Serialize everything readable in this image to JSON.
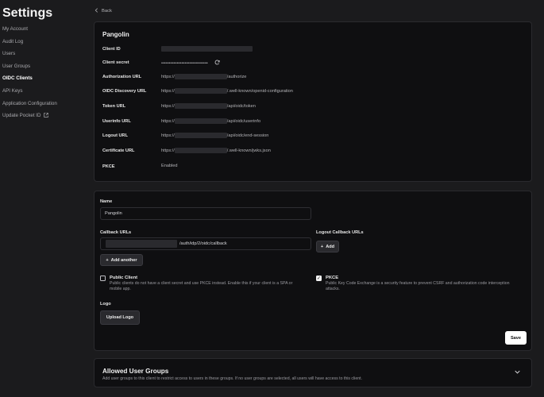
{
  "sidebar": {
    "title": "Settings",
    "items": [
      {
        "label": "My Account"
      },
      {
        "label": "Audit Log"
      },
      {
        "label": "Users"
      },
      {
        "label": "User Groups"
      },
      {
        "label": "OIDC Clients",
        "active": true
      },
      {
        "label": "API Keys"
      },
      {
        "label": "Application Configuration"
      },
      {
        "label": "Update Pocket ID"
      }
    ]
  },
  "back": {
    "label": "Back"
  },
  "client": {
    "name": "Pangolin",
    "fields": {
      "client_id": {
        "label": "Client ID"
      },
      "client_secret": {
        "label": "Client secret",
        "value": "••••••••••••••••••••••••••••••"
      },
      "authorization_url": {
        "label": "Authorization URL",
        "prefix": "https://",
        "suffix": "/authorize"
      },
      "discovery_url": {
        "label": "OIDC Discovery URL",
        "prefix": "https://",
        "suffix": "/.well-known/openid-configuration"
      },
      "token_url": {
        "label": "Token URL",
        "prefix": "https://",
        "suffix": "/api/oidc/token"
      },
      "userinfo_url": {
        "label": "Userinfo URL",
        "prefix": "https://",
        "suffix": "/api/oidc/userinfo"
      },
      "logout_url": {
        "label": "Logout URL",
        "prefix": "https://",
        "suffix": "/api/oidc/end-session"
      },
      "certificate_url": {
        "label": "Certificate URL",
        "prefix": "https://",
        "suffix": "/.well-known/jwks.json"
      },
      "pkce": {
        "label": "PKCE",
        "value": "Enabled"
      }
    }
  },
  "form": {
    "name_label": "Name",
    "name_value": "Pangolin",
    "callback_label": "Callback URLs",
    "callback_suffix": "/auth/idp/2/oidc/callback",
    "add_another": "Add another",
    "logout_callback_label": "Logout Callback URLs",
    "add_label": "Add",
    "public_client": {
      "title": "Public Client",
      "checked": false,
      "desc": "Public clients do not have a client secret and use PKCE instead. Enable this if your client is a SPA or mobile app."
    },
    "pkce": {
      "title": "PKCE",
      "checked": true,
      "desc": "Public Key Code Exchange is a security feature to prevent CSRF and authorization code interception attacks."
    },
    "logo_label": "Logo",
    "upload_logo": "Upload Logo",
    "save": "Save"
  },
  "allowed_groups": {
    "title": "Allowed User Groups",
    "desc": "Add user groups to this client to restrict access to users in these groups. If no user groups are selected, all users will have access to this client."
  },
  "icons": {
    "back": "chevron-left-icon",
    "refresh": "refresh-icon",
    "external": "external-link-icon",
    "add": "plus-icon",
    "expand": "chevron-down-icon"
  }
}
